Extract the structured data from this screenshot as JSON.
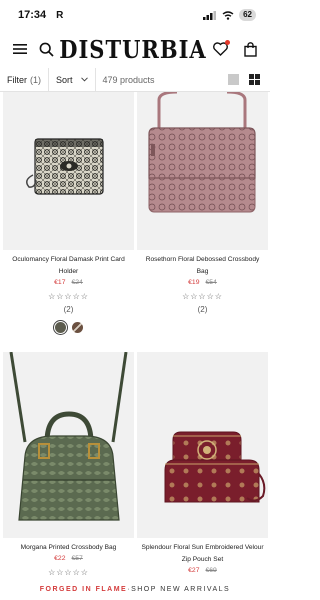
{
  "status": {
    "time": "17:34",
    "carrier": "R",
    "battery": "62"
  },
  "header": {
    "logo": "DISTURBIA"
  },
  "filters": {
    "filter_label": "Filter",
    "filter_count": "(1)",
    "sort_label": "Sort",
    "product_count": "479 products"
  },
  "products": [
    {
      "name": "Oculomancy Floral Damask Print Card Holder",
      "price": "€17",
      "was": "€24",
      "rating": 0,
      "reviews": "(2)",
      "swatches": [
        "#5c5c4e",
        "#8a6e55"
      ]
    },
    {
      "name": "Rosethorn Floral Debossed Crossbody Bag",
      "price": "€19",
      "was": "€54",
      "rating": 0,
      "reviews": "(2)"
    },
    {
      "name": "Morgana Printed Crossbody Bag",
      "price": "€22",
      "was": "€57",
      "rating": 0
    },
    {
      "name": "Splendour Floral Sun Embroidered Velour Zip Pouch Set",
      "price": "€27",
      "was": "€69"
    }
  ],
  "promo": {
    "highlight": "FORGED IN FLAME",
    "separator": " · ",
    "text": "SHOP NEW ARRIVALS"
  },
  "colors": {
    "accent": "#d43b3b",
    "card_bg": "#f1f1f1",
    "stars": "#555555"
  },
  "icons": [
    "menu-icon",
    "search-icon",
    "heart-icon",
    "bag-icon",
    "chevron-down-icon",
    "single-view-icon",
    "grid-view-icon",
    "star-icon"
  ]
}
